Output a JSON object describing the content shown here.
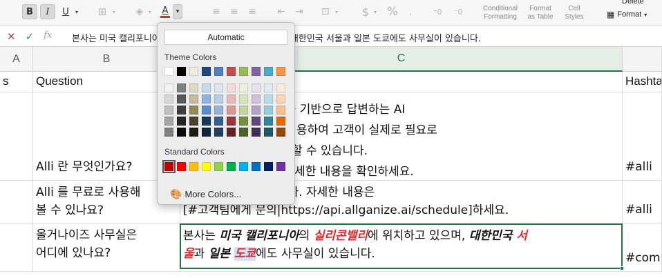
{
  "ribbon": {
    "bold": "B",
    "italic": "I",
    "underline": "U",
    "font_color": "A",
    "currency": "$",
    "percent": "%",
    "conditional_formatting": "Conditional Formatting",
    "format_as_table": "Format as Table",
    "cell_styles": "Cell Styles",
    "delete": "Delete",
    "format": "Format"
  },
  "formula_bar": {
    "fx": "fx",
    "content": "본사는 미국 캘리포니아의 실리콘밸리에 위치하고 있으며, 대한민국 서울과 일본 도쿄에도 사무실이 있습니다."
  },
  "columns": [
    "A",
    "B",
    "C"
  ],
  "headers": {
    "a": "s",
    "b": "Question",
    "d": "Hashta"
  },
  "rows": [
    {
      "question": "Alli 란 무엇인가요?",
      "answer": [
        "로 사전에 학습된 AI 를 기반으로 답변하는 AI",
        "축되어 있는 FAQ 를 이용하여 고객이 실제로 필요로",
        "고 필요한 액션을 진행할 수 있습니다.",
        "allganize.ai/]에서 자세한 내용을 확인하세요."
      ],
      "hashtag": "#alli"
    },
    {
      "question": [
        "Alli 를 무료로 사용해",
        "볼 수 있나요?"
      ],
      "answer": [
        "험을 제공하고 있습니다. 자세한 내용은",
        "[#고객팀에게 문의|https://api.allganize.ai/schedule]하세요."
      ],
      "hashtag": "#alli"
    },
    {
      "question": [
        "올거나이즈 사무실은",
        "어디에 있나요?"
      ],
      "answer_parts": {
        "p1": "본사는 ",
        "p2": "미국 캘리포니아",
        "p3": "의 ",
        "p4": "실리콘밸리",
        "p5": "에 위치하고 있으며, ",
        "p6": "대한민국 ",
        "p7": "서",
        "p8": "울",
        "p9": "과 ",
        "p10": "일본 ",
        "p11": "도쿄",
        "p12": "에도 사무실이 있습니다."
      },
      "hashtag": "#comp"
    }
  ],
  "color_picker": {
    "automatic": "Automatic",
    "theme_colors_label": "Theme Colors",
    "standard_colors_label": "Standard Colors",
    "more_colors": "More Colors...",
    "theme_top": [
      "#ffffff",
      "#000000",
      "#eeece1",
      "#1f497d",
      "#4f81bd",
      "#c0504d",
      "#9bbb59",
      "#8064a2",
      "#4bacc6",
      "#f79646"
    ],
    "theme_shades": [
      [
        "#f2f2f2",
        "#7f7f7f",
        "#ddd9c3",
        "#c6d9f0",
        "#dbe5f1",
        "#f2dcdb",
        "#ebf1dd",
        "#e5e0ec",
        "#dbeef3",
        "#fdeada"
      ],
      [
        "#d8d8d8",
        "#595959",
        "#c4bd97",
        "#8db3e2",
        "#b8cce4",
        "#e5b9b7",
        "#d7e3bc",
        "#ccc1d9",
        "#b7dde8",
        "#fbd5b5"
      ],
      [
        "#bfbfbf",
        "#3f3f3f",
        "#938953",
        "#548dd4",
        "#95b3d7",
        "#d99694",
        "#c3d69b",
        "#b2a2c7",
        "#92cddc",
        "#fac08f"
      ],
      [
        "#a5a5a5",
        "#262626",
        "#494429",
        "#17365d",
        "#366092",
        "#953734",
        "#76923c",
        "#5f497a",
        "#31859b",
        "#e36c09"
      ],
      [
        "#7f7f7f",
        "#0c0c0c",
        "#1d1b10",
        "#0f243e",
        "#244061",
        "#632423",
        "#4f6128",
        "#3f3151",
        "#205867",
        "#974806"
      ]
    ],
    "standard": [
      "#c00000",
      "#ff0000",
      "#ffc000",
      "#ffff00",
      "#92d050",
      "#00b050",
      "#00b0f0",
      "#0070c0",
      "#002060",
      "#7030a0"
    ],
    "selected_standard_index": 0
  }
}
